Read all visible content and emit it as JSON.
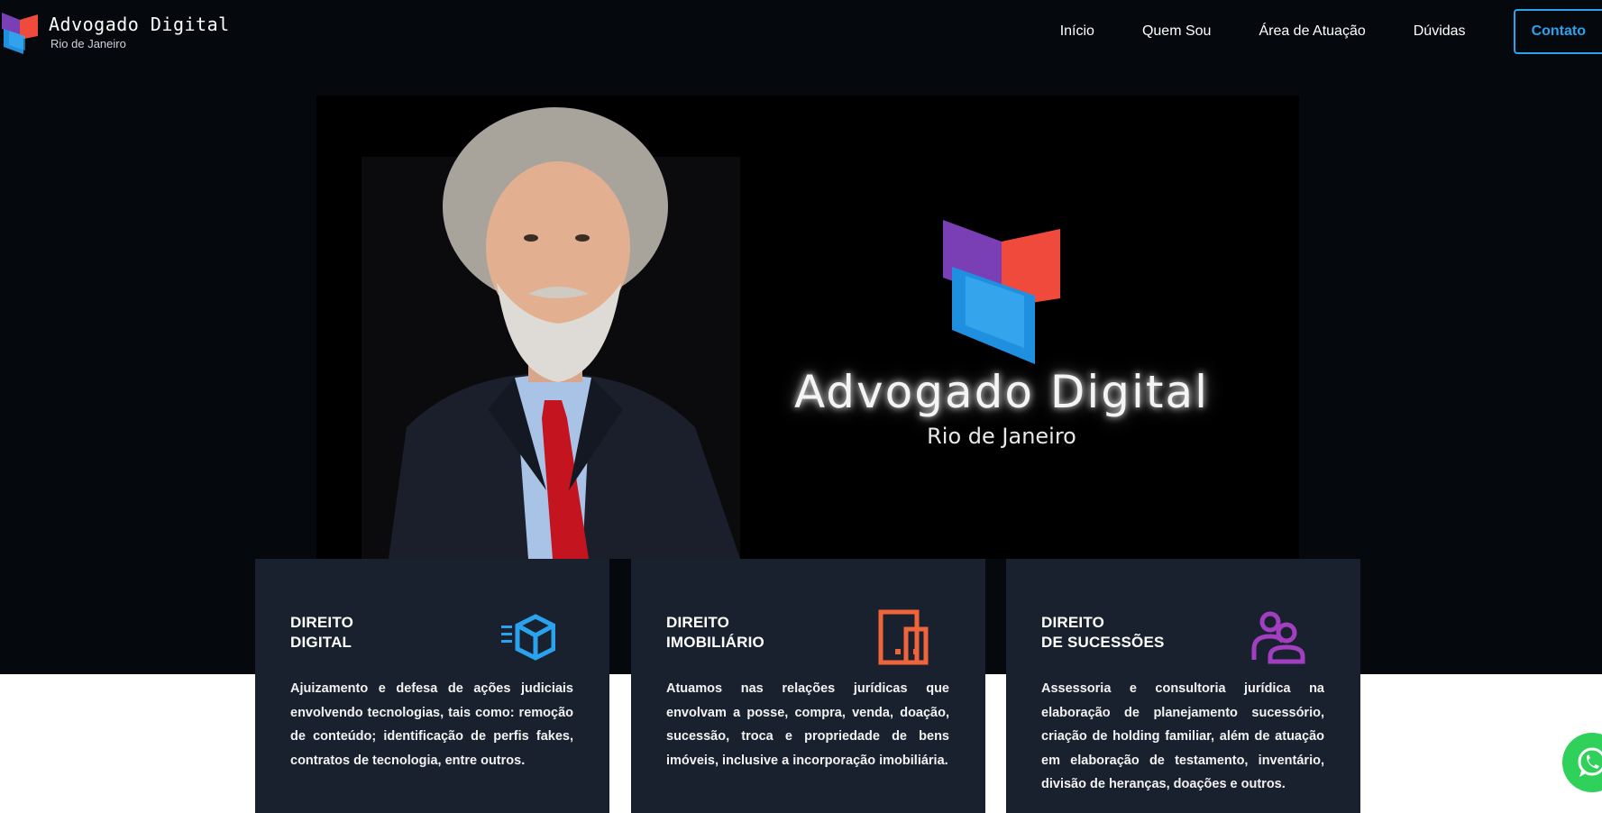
{
  "header": {
    "logo_title": "Advogado Digital",
    "logo_subtitle": "Rio de Janeiro",
    "nav": [
      "Início",
      "Quem Sou",
      "Área de Atuação",
      "Dúvidas"
    ],
    "cta": "Contato"
  },
  "hero": {
    "brand_title": "Advogado Digital",
    "brand_subtitle": "Rio de Janeiro"
  },
  "cards": [
    {
      "title_line1": "DIREITO",
      "title_line2": "DIGITAL",
      "icon": "cube-icon",
      "icon_color": "#2aa3ee",
      "text": "Ajuizamento e defesa de ações judiciais envolvendo tecnologias, tais como: remoção de conteúdo; identificação de perfis fakes, contratos de tecnologia, entre outros."
    },
    {
      "title_line1": "DIREITO",
      "title_line2": "IMOBILIÁRIO",
      "icon": "building-icon",
      "icon_color": "#f0643c",
      "text": "Atuamos nas relações jurídicas que envolvam a posse, compra, venda, doação, sucessão, troca e propriedade de bens imóveis, inclusive a incorporação imobiliária."
    },
    {
      "title_line1": "DIREITO",
      "title_line2": "DE SUCESSÕES",
      "icon": "users-icon",
      "icon_color": "#a13fc0",
      "text": "Assessoria e consultoria jurídica na elaboração de planejamento sucessório, criação de holding familiar, além de atuação em elaboração de testamento, inventário, divisão de heranças, doações e outros."
    }
  ],
  "colors": {
    "accent_blue": "#2aa3ee",
    "card_bg": "#1a212e",
    "page_dark": "#05080d",
    "whatsapp_green": "#2fd15a"
  },
  "whatsapp_icon": "whatsapp-icon"
}
